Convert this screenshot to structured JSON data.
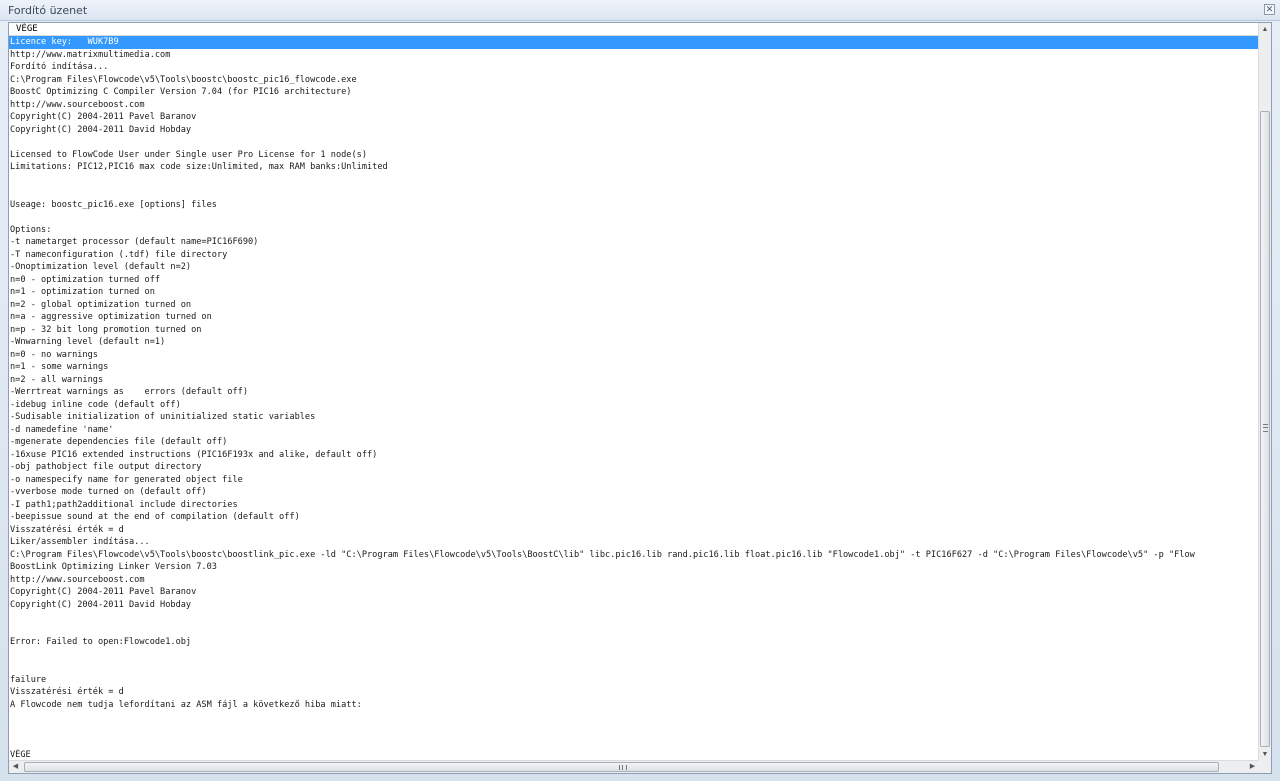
{
  "window": {
    "title": "Fordító üzenet",
    "close_glyph": "✕"
  },
  "console": {
    "header": "VÉGE",
    "selected_index": 0,
    "lines": [
      "Licence key:   WUK7B9",
      "http://www.matrixmultimedia.com",
      "Fordító indítása...",
      "C:\\Program Files\\Flowcode\\v5\\Tools\\boostc\\boostc_pic16_flowcode.exe",
      "BoostC Optimizing C Compiler Version 7.04 (for PIC16 architecture)",
      "http://www.sourceboost.com",
      "Copyright(C) 2004-2011 Pavel Baranov",
      "Copyright(C) 2004-2011 David Hobday",
      "",
      "Licensed to FlowCode User under Single user Pro License for 1 node(s)",
      "Limitations: PIC12,PIC16 max code size:Unlimited, max RAM banks:Unlimited",
      "",
      "",
      "Useage: boostc_pic16.exe [options] files",
      "",
      "Options:",
      "-t nametarget processor (default name=PIC16F690)",
      "-T nameconfiguration (.tdf) file directory",
      "-Onoptimization level (default n=2)",
      "n=0 - optimization turned off",
      "n=1 - optimization turned on",
      "n=2 - global optimization turned on",
      "n=a - aggressive optimization turned on",
      "n=p - 32 bit long promotion turned on",
      "-Wnwarning level (default n=1)",
      "n=0 - no warnings",
      "n=1 - some warnings",
      "n=2 - all warnings",
      "-Werrtreat warnings as    errors (default off)",
      "-idebug inline code (default off)",
      "-Sudisable initialization of uninitialized static variables",
      "-d namedefine 'name'",
      "-mgenerate dependencies file (default off)",
      "-16xuse PIC16 extended instructions (PIC16F193x and alike, default off)",
      "-obj pathobject file output directory",
      "-o namespecify name for generated object file",
      "-vverbose mode turned on (default off)",
      "-I path1;path2additional include directories",
      "-beepissue sound at the end of compilation (default off)",
      "Visszatérési érték = d",
      "Liker/assembler indítása...",
      "C:\\Program Files\\Flowcode\\v5\\Tools\\boostc\\boostlink_pic.exe -ld \"C:\\Program Files\\Flowcode\\v5\\Tools\\BoostC\\lib\" libc.pic16.lib rand.pic16.lib float.pic16.lib \"Flowcode1.obj\" -t PIC16F627 -d \"C:\\Program Files\\Flowcode\\v5\" -p \"Flow",
      "BoostLink Optimizing Linker Version 7.03",
      "http://www.sourceboost.com",
      "Copyright(C) 2004-2011 Pavel Baranov",
      "Copyright(C) 2004-2011 David Hobday",
      "",
      "",
      "Error: Failed to open:Flowcode1.obj",
      "",
      "",
      "failure",
      "Visszatérési érték = d",
      "A Flowcode nem tudja lefordítani az ASM fájl a következő hiba miatt:",
      "",
      "",
      "",
      "VÉGE"
    ]
  },
  "scrollbars": {
    "vertical": {
      "up": "▲",
      "down": "▼"
    },
    "horizontal": {
      "left": "◀",
      "right": "▶"
    }
  }
}
